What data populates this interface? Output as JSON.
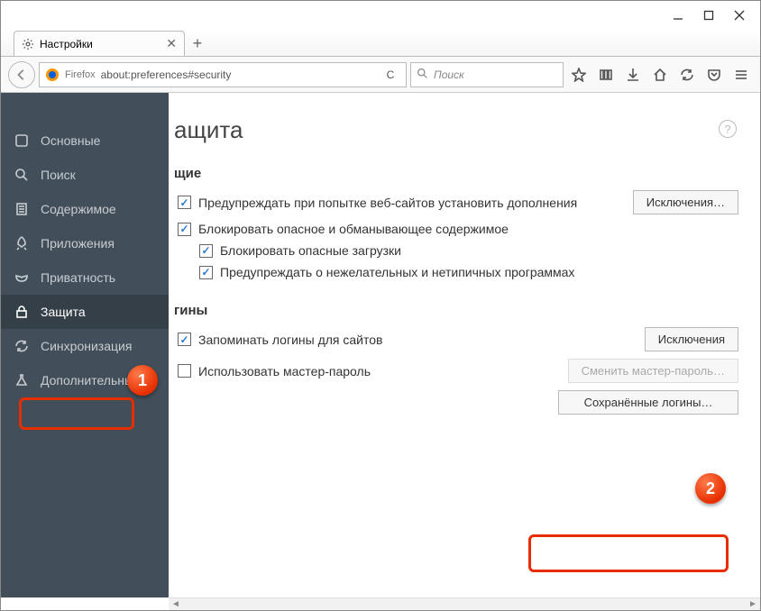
{
  "window": {
    "minimize": "—",
    "maximize": "□",
    "close": "✕"
  },
  "tab": {
    "title": "Настройки",
    "close": "✕",
    "new": "+"
  },
  "urlbar": {
    "brand": "Firefox",
    "url": "about:preferences#security",
    "reload": "C"
  },
  "searchbar": {
    "placeholder": "Поиск",
    "icon": "🔍"
  },
  "sidebar": {
    "items": [
      {
        "label": "Основные"
      },
      {
        "label": "Поиск"
      },
      {
        "label": "Содержимое"
      },
      {
        "label": "Приложения"
      },
      {
        "label": "Приватность"
      },
      {
        "label": "Защита"
      },
      {
        "label": "Синхронизация"
      },
      {
        "label": "Дополнительные"
      }
    ]
  },
  "page": {
    "title": "ащита",
    "help": "?",
    "general": {
      "heading": "щие",
      "warn_addons": "Предупреждать при попытке веб-сайтов установить дополнения",
      "exceptions": "Исключения…",
      "block_dangerous": "Блокировать опасное и обманывающее содержимое",
      "block_downloads": "Блокировать опасные загрузки",
      "warn_unwanted": "Предупреждать о нежелательных и нетипичных программах"
    },
    "logins": {
      "heading": "гины",
      "remember": "Запоминать логины для сайтов",
      "exceptions": "Исключения",
      "use_master": "Использовать мастер-пароль",
      "change_master": "Сменить мастер-пароль…",
      "saved": "Сохранённые логины…"
    }
  },
  "markers": {
    "one": "1",
    "two": "2"
  }
}
